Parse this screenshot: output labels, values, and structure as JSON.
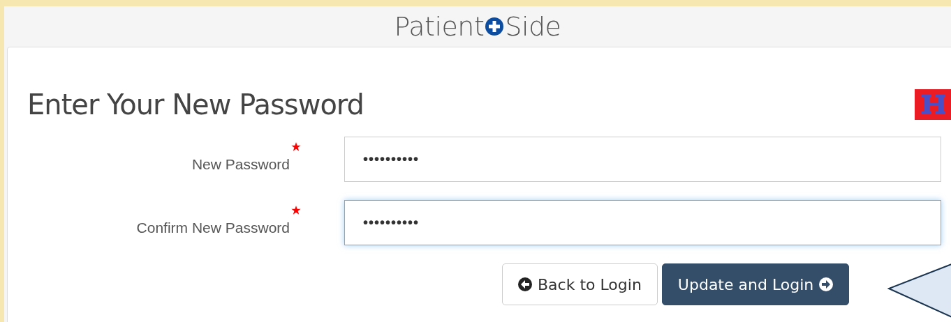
{
  "brand": {
    "left": "Patient",
    "right": "Side"
  },
  "form": {
    "title": "Enter Your New Password",
    "fields": [
      {
        "label": "New Password",
        "required": true,
        "value": "••••••••••",
        "focused": false
      },
      {
        "label": "Confirm New Password",
        "required": true,
        "value": "••••••••••",
        "focused": true
      }
    ],
    "buttons": [
      {
        "label": "Back to Login",
        "kind": "back"
      },
      {
        "label": "Update and Login",
        "kind": "submit"
      }
    ]
  }
}
